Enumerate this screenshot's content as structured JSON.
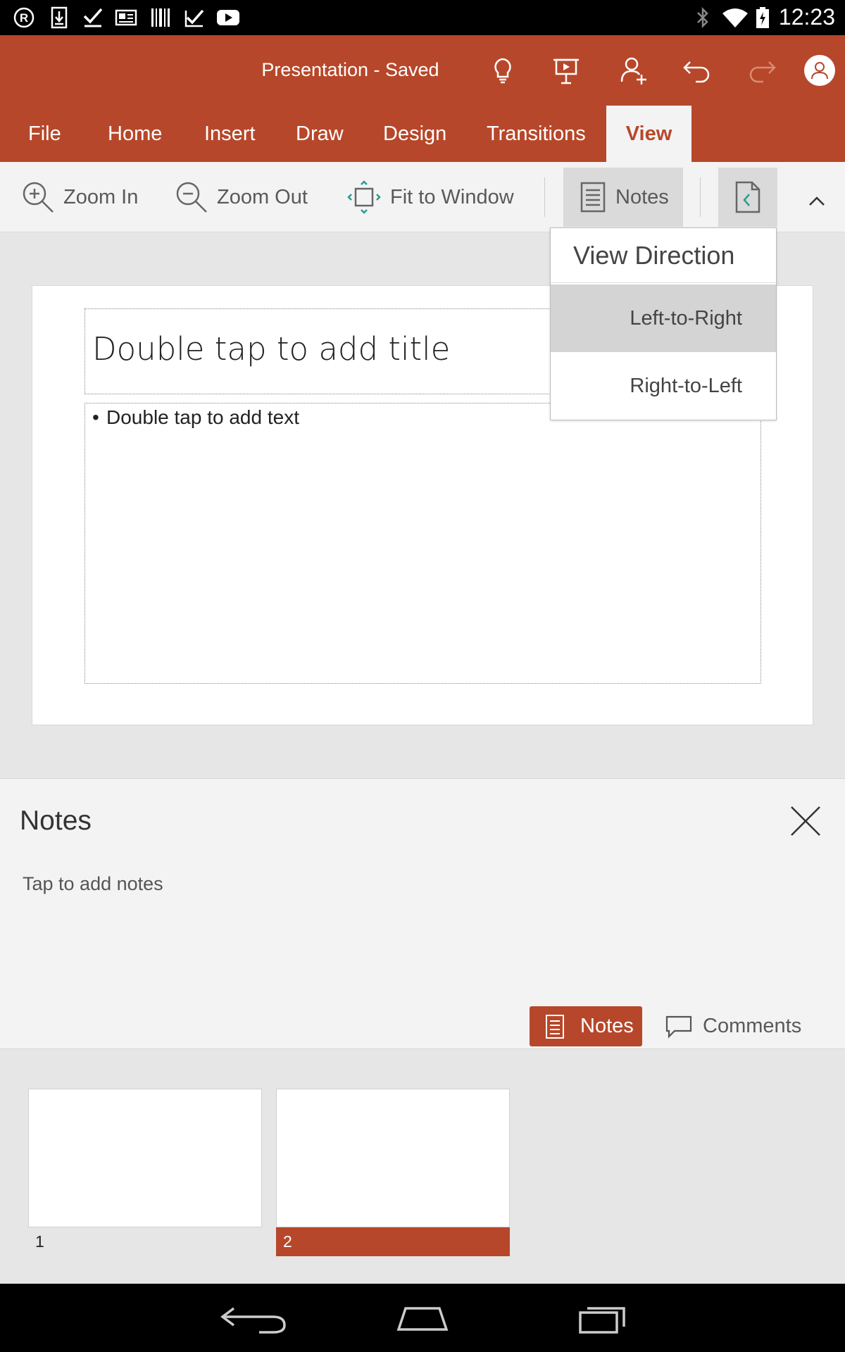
{
  "status_bar": {
    "time": "12:23",
    "left_icons": [
      "registered-icon",
      "download-icon",
      "check-icon",
      "news-icon",
      "barcode-icon",
      "checklist-icon",
      "youtube-icon"
    ],
    "right_icons": [
      "bluetooth-icon",
      "wifi-icon",
      "battery-icon"
    ]
  },
  "title_bar": {
    "title": "Presentation - Saved",
    "icons": [
      "lightbulb-icon",
      "present-icon",
      "share-icon",
      "undo-icon",
      "redo-icon",
      "account-icon"
    ]
  },
  "ribbon": {
    "tabs": [
      {
        "label": "File"
      },
      {
        "label": "Home"
      },
      {
        "label": "Insert"
      },
      {
        "label": "Draw"
      },
      {
        "label": "Design"
      },
      {
        "label": "Transitions"
      },
      {
        "label": "View",
        "active": true
      }
    ],
    "more_icon": "chevron-down-icon"
  },
  "toolbar": {
    "zoom_in": "Zoom In",
    "zoom_out": "Zoom Out",
    "fit": "Fit to Window",
    "notes": "Notes",
    "direction_icon": "page-direction-icon",
    "collapse_icon": "chevron-up-icon"
  },
  "dropdown": {
    "header": "View Direction",
    "items": [
      {
        "label": "Left-to-Right",
        "selected": true
      },
      {
        "label": "Right-to-Left",
        "selected": false
      }
    ]
  },
  "slide": {
    "title_placeholder": "Double tap to add title",
    "body_placeholder": "Double tap to add text",
    "bullet": "•"
  },
  "notes_pane": {
    "title": "Notes",
    "placeholder": "Tap to add notes",
    "notes_button": "Notes",
    "comments_button": "Comments"
  },
  "thumbnails": [
    {
      "number": "1",
      "selected": false
    },
    {
      "number": "2",
      "selected": true
    }
  ],
  "colors": {
    "accent": "#b7472a",
    "ribbon_bg": "#f3f3f3",
    "workspace_bg": "#e6e6e6"
  }
}
